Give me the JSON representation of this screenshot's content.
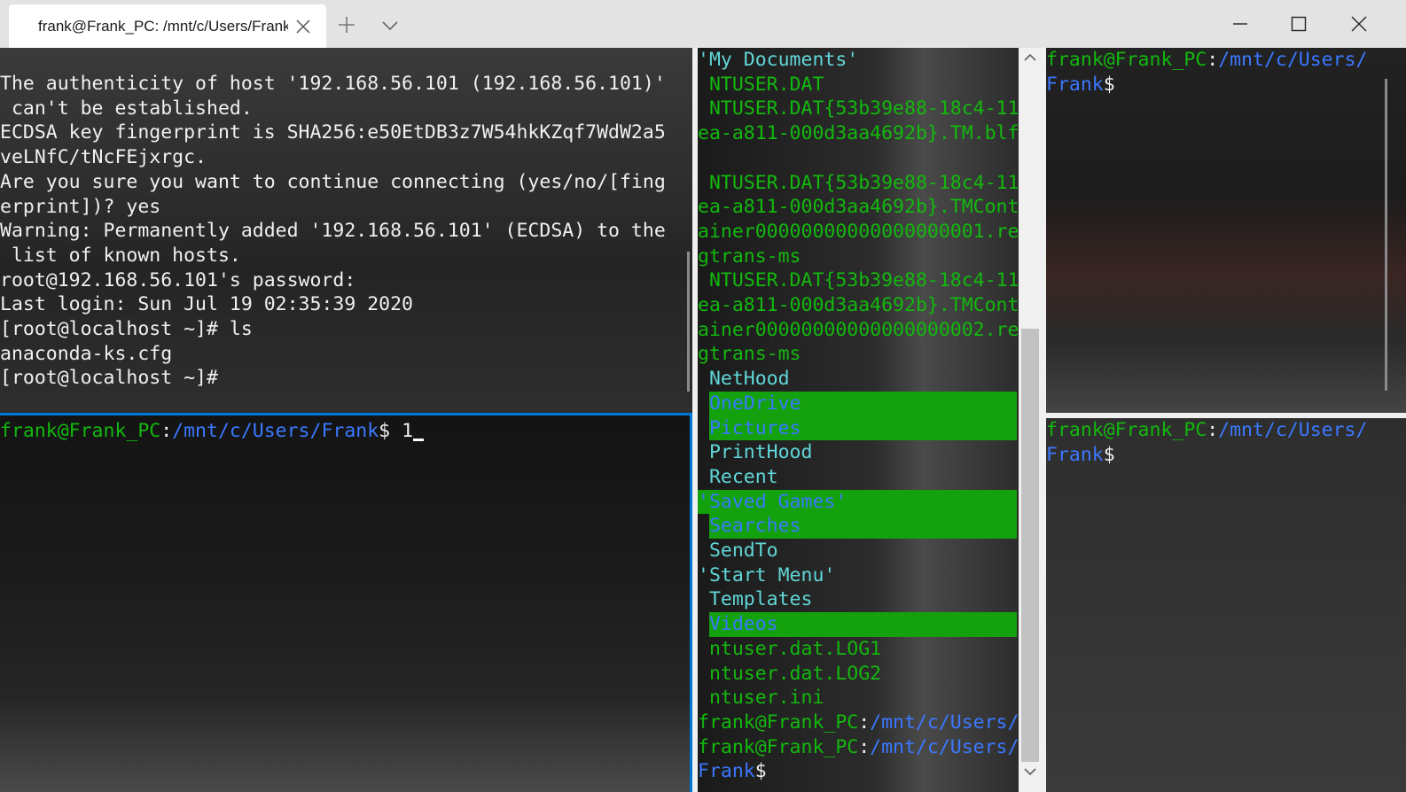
{
  "window": {
    "tab_title": "frank@Frank_PC: /mnt/c/Users/Frank",
    "icons": [
      "close-icon",
      "plus-icon",
      "chevron-down-icon",
      "minimize-icon",
      "maximize-icon",
      "close-window-icon"
    ]
  },
  "pane_ssh": {
    "lines": [
      "The authenticity of host '192.168.56.101 (192.168.56.101)'",
      " can't be established.",
      "ECDSA key fingerprint is SHA256:e50EtDB3z7W54hkKZqf7WdW2a5",
      "veLNfC/tNcFEjxrgc.",
      "Are you sure you want to continue connecting (yes/no/[fing",
      "erprint])? yes",
      "Warning: Permanently added '192.168.56.101' (ECDSA) to the",
      " list of known hosts.",
      "root@192.168.56.101's password:",
      "Last login: Sun Jul 19 02:35:39 2020",
      "[root@localhost ~]# ls",
      "anaconda-ks.cfg",
      "[root@localhost ~]#"
    ]
  },
  "pane_active": {
    "user": "frank@Frank_PC",
    "colon": ":",
    "path": "/mnt/c/Users/Frank",
    "dollar": "$ ",
    "input": "1"
  },
  "pane_listing": {
    "lines": [
      {
        "text": "'My Documents'",
        "style": "cyan"
      },
      {
        "text": " NTUSER.DAT",
        "style": "green"
      },
      {
        "text": " NTUSER.DAT{53b39e88-18c4-11",
        "style": "green"
      },
      {
        "text": "ea-a811-000d3aa4692b}.TM.blf",
        "style": "green"
      },
      {
        "text": "",
        "style": "green"
      },
      {
        "text": " NTUSER.DAT{53b39e88-18c4-11",
        "style": "green"
      },
      {
        "text": "ea-a811-000d3aa4692b}.TMCont",
        "style": "green"
      },
      {
        "text": "ainer00000000000000000001.re",
        "style": "green"
      },
      {
        "text": "gtrans-ms",
        "style": "green"
      },
      {
        "text": " NTUSER.DAT{53b39e88-18c4-11",
        "style": "green"
      },
      {
        "text": "ea-a811-000d3aa4692b}.TMCont",
        "style": "green"
      },
      {
        "text": "ainer00000000000000000002.re",
        "style": "green"
      },
      {
        "text": "gtrans-ms",
        "style": "green"
      },
      {
        "text": " NetHood",
        "style": "cyan"
      },
      {
        "text": " OneDrive",
        "style": "hl"
      },
      {
        "text": " Pictures",
        "style": "hl"
      },
      {
        "text": " PrintHood",
        "style": "cyan"
      },
      {
        "text": " Recent",
        "style": "cyan"
      },
      {
        "text": "'Saved Games'",
        "style": "hl"
      },
      {
        "text": " Searches",
        "style": "hl"
      },
      {
        "text": " SendTo",
        "style": "cyan"
      },
      {
        "text": "'Start Menu'",
        "style": "cyan"
      },
      {
        "text": " Templates",
        "style": "cyan"
      },
      {
        "text": " Videos",
        "style": "hl"
      },
      {
        "text": " ntuser.dat.LOG1",
        "style": "green"
      },
      {
        "text": " ntuser.dat.LOG2",
        "style": "green"
      },
      {
        "text": " ntuser.ini",
        "style": "green"
      }
    ],
    "prompts": [
      {
        "user": "frank@Frank_PC",
        "colon": ":",
        "path": "/mnt/c/Users/"
      },
      {
        "user": "frank@Frank_PC",
        "colon": ":",
        "path": "/mnt/c/Users/"
      }
    ],
    "tail": {
      "path": "Frank",
      "dollar": "$"
    }
  },
  "pane_top_right": {
    "user": "frank@Frank_PC",
    "colon": ":",
    "path": "/mnt/c/Users/",
    "path2": "Frank",
    "dollar": "$"
  },
  "pane_bottom_right": {
    "user": "frank@Frank_PC",
    "colon": ":",
    "path": "/mnt/c/Users/",
    "path2": "Frank",
    "dollar": "$"
  },
  "colors": {
    "prompt_user": "#13b80e",
    "prompt_path": "#3b78ff",
    "highlight_bg": "#13a10e",
    "focus_border": "#0078d7"
  }
}
